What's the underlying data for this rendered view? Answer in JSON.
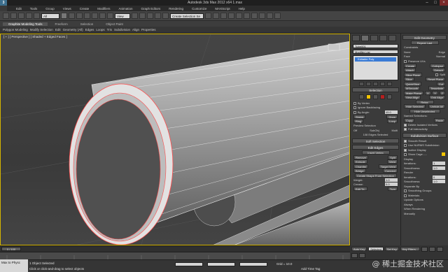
{
  "window": {
    "title": "Autodesk 3ds Max 2012 x64    1.max",
    "logo": "3"
  },
  "menu": [
    "Edit",
    "Tools",
    "Group",
    "Views",
    "Create",
    "Modifiers",
    "Animation",
    "Graph Editors",
    "Rendering",
    "Customize",
    "MAXScript",
    "Help"
  ],
  "toolbar": {
    "selection_filter": "All",
    "coord_system": "View",
    "named_selection": "Create Selection Se"
  },
  "ribbon": {
    "tabs": [
      "Graphite Modeling Tools",
      "Freeform",
      "Selection",
      "Object Paint"
    ],
    "subtabs": [
      "Polygon Modeling",
      "Modify Selection",
      "Edit",
      "Geometry (All)",
      "Edges",
      "Loops",
      "Tris",
      "Subdivision",
      "Align",
      "Properties"
    ]
  },
  "viewport": {
    "label": "[ + ] [ Perspective ] [ Shaded + Edged Faces ]"
  },
  "command_panel": {
    "object_name": "Tube001",
    "modifier_list_label": "Modifier List",
    "modifier_stack": [
      "Editable Poly"
    ],
    "selection": {
      "header": "Selection",
      "by_vertex": "By Vertex",
      "ignore_backfacing": "Ignore Backfacing",
      "by_angle": "By Angle:",
      "by_angle_value": "45.0",
      "shrink": "Shrink",
      "grow": "Grow",
      "ring": "Ring",
      "loop": "Loop",
      "preview_selection": "Preview Selection",
      "off": "Off",
      "subobj": "SubObj",
      "multi": "Multi",
      "status": "108 Edges Selected"
    },
    "soft_selection": {
      "header": "Soft Selection"
    },
    "edit_edges": {
      "header": "Edit Edges",
      "insert_vertex": "Insert Vertex",
      "remove": "Remove",
      "split": "Split",
      "extrude": "Extrude",
      "weld": "Weld",
      "chamfer": "Chamfer",
      "target_weld": "Target Weld",
      "bridge": "Bridge",
      "connect": "Connect",
      "create_shape": "Create Shape From Selection",
      "weight_label": "Weight:",
      "weight": "1.0",
      "crease_label": "Crease:",
      "crease": "0.0",
      "edit_tri": "Edit Tri.",
      "turn": "Turn"
    }
  },
  "edit_panel": {
    "edit_geometry": "Edit Geometry",
    "repeat_last": "Repeat Last",
    "constraints": "Constraints",
    "none": "None",
    "edge": "Edge",
    "face": "Face",
    "normal": "Normal",
    "preserve_uvs": "Preserve UVs",
    "create": "Create",
    "collapse": "Collapse",
    "attach": "Attach",
    "detach": "Detach",
    "slice_plane": "Slice Plane",
    "split": "Split",
    "slice": "Slice",
    "reset_plane": "Reset Plane",
    "quickslice": "QuickSlice",
    "cut": "Cut",
    "meshsmooth": "MSmooth",
    "tessellate": "Tessellate",
    "make_planar": "Make Planar",
    "xyz": [
      "X",
      "Y",
      "Z"
    ],
    "view_align": "View Align",
    "grid_align": "Grid Align",
    "relax": "Relax",
    "hide_selected": "Hide Selected",
    "unhide_all": "Unhide All",
    "hide_unselected": "Hide Unselected",
    "named_selections": "Named Selections:",
    "copy": "Copy",
    "paste": "Paste",
    "delete_isolated": "Delete Isolated Vertices",
    "full_interactivity": "Full Interactivity",
    "subdivision_surface": "Subdivision Surface",
    "smooth_result": "Smooth Result",
    "use_nurms": "Use NURMS Subdivision",
    "isoline_display": "Isoline Display",
    "show_cage": "Show Cage......",
    "display": "Display",
    "iterations": "Iterations:",
    "iterations_value": "1",
    "smoothness": "Smoothness:",
    "smoothness_value": "1.0",
    "render": "Render",
    "render_iterations": "0",
    "render_smoothness": "1.0",
    "separate_by": "Separate By",
    "smoothing_groups": "Smoothing Groups",
    "materials": "Materials",
    "update_options": "Update Options",
    "always": "Always",
    "when_rendering": "When Rendering",
    "manually": "Manually"
  },
  "timeline": {
    "frame": "0 / 100"
  },
  "status": {
    "maxscript": "Max to Physc",
    "line1": "1 Object Selected",
    "line2": "Click or click-and-drag to select objects",
    "grid": "Grid = 10.0",
    "auto_key": "Auto Key",
    "selected": "Selected",
    "set_key": "Set Key",
    "key_filters": "Key Filters...",
    "add_time_tag": "Add Time Tag"
  },
  "watermark": "@ 稀土掘金技术社区"
}
